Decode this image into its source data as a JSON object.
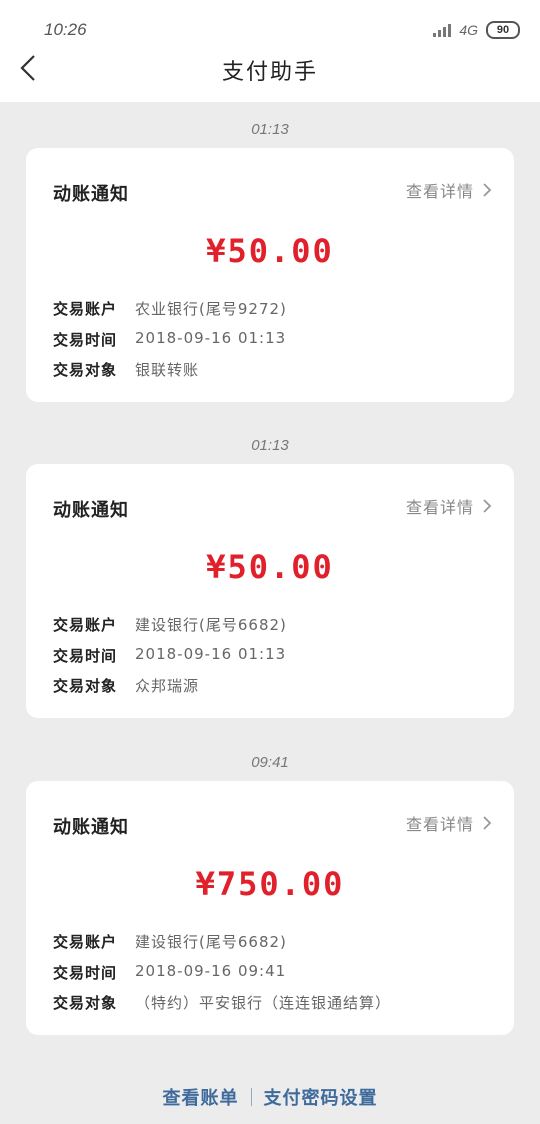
{
  "status": {
    "time": "10:26",
    "network": "4G",
    "battery": "90"
  },
  "header": {
    "title": "支付助手"
  },
  "notifications": [
    {
      "time": "01:13",
      "title": "动账通知",
      "detail_label": "查看详情",
      "amount": "¥50.00",
      "rows": [
        {
          "key": "交易账户",
          "value": "农业银行(尾号9272)"
        },
        {
          "key": "交易时间",
          "value": "2018-09-16 01:13"
        },
        {
          "key": "交易对象",
          "value": "银联转账"
        }
      ]
    },
    {
      "time": "01:13",
      "title": "动账通知",
      "detail_label": "查看详情",
      "amount": "¥50.00",
      "rows": [
        {
          "key": "交易账户",
          "value": "建设银行(尾号6682)"
        },
        {
          "key": "交易时间",
          "value": "2018-09-16 01:13"
        },
        {
          "key": "交易对象",
          "value": "众邦瑞源"
        }
      ]
    },
    {
      "time": "09:41",
      "title": "动账通知",
      "detail_label": "查看详情",
      "amount": "¥750.00",
      "rows": [
        {
          "key": "交易账户",
          "value": "建设银行(尾号6682)"
        },
        {
          "key": "交易时间",
          "value": "2018-09-16 09:41"
        },
        {
          "key": "交易对象",
          "value": "（特约）平安银行（连连银通结算）"
        }
      ]
    }
  ],
  "footer": {
    "bill_link": "查看账单",
    "pin_link": "支付密码设置"
  },
  "colors": {
    "amount": "#e0202a",
    "link": "#3f6b9c",
    "background": "#ececec"
  }
}
